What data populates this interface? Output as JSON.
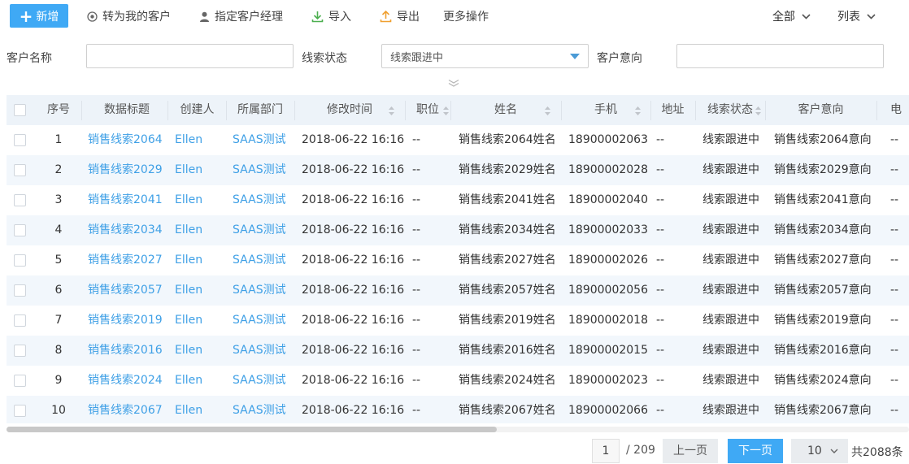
{
  "toolbar": {
    "add_label": "新增",
    "convert_label": "转为我的客户",
    "assign_label": "指定客户经理",
    "import_label": "导入",
    "export_label": "导出",
    "more_label": "更多操作",
    "scope_label": "全部",
    "view_label": "列表"
  },
  "filters": {
    "customer_name_label": "客户名称",
    "customer_name_value": "",
    "status_label": "线索状态",
    "status_value": "线索跟进中",
    "intent_label": "客户意向",
    "intent_value": ""
  },
  "table": {
    "columns": [
      "序号",
      "数据标题",
      "创建人",
      "所属部门",
      "修改时间",
      "职位",
      "姓名",
      "手机",
      "地址",
      "线索状态",
      "客户意向",
      "电"
    ],
    "rows": [
      {
        "no": "1",
        "title": "销售线索2064",
        "creator": "Ellen",
        "dept": "SAAS测试",
        "time": "2018-06-22 16:16",
        "position": "--",
        "name": "销售线索2064姓名",
        "phone": "18900002063",
        "address": "--",
        "status": "线索跟进中",
        "intent": "销售线索2064意向",
        "tel": "--"
      },
      {
        "no": "2",
        "title": "销售线索2029",
        "creator": "Ellen",
        "dept": "SAAS测试",
        "time": "2018-06-22 16:16",
        "position": "--",
        "name": "销售线索2029姓名",
        "phone": "18900002028",
        "address": "--",
        "status": "线索跟进中",
        "intent": "销售线索2029意向",
        "tel": "--"
      },
      {
        "no": "3",
        "title": "销售线索2041",
        "creator": "Ellen",
        "dept": "SAAS测试",
        "time": "2018-06-22 16:16",
        "position": "--",
        "name": "销售线索2041姓名",
        "phone": "18900002040",
        "address": "--",
        "status": "线索跟进中",
        "intent": "销售线索2041意向",
        "tel": "--"
      },
      {
        "no": "4",
        "title": "销售线索2034",
        "creator": "Ellen",
        "dept": "SAAS测试",
        "time": "2018-06-22 16:16",
        "position": "--",
        "name": "销售线索2034姓名",
        "phone": "18900002033",
        "address": "--",
        "status": "线索跟进中",
        "intent": "销售线索2034意向",
        "tel": "--"
      },
      {
        "no": "5",
        "title": "销售线索2027",
        "creator": "Ellen",
        "dept": "SAAS测试",
        "time": "2018-06-22 16:16",
        "position": "--",
        "name": "销售线索2027姓名",
        "phone": "18900002026",
        "address": "--",
        "status": "线索跟进中",
        "intent": "销售线索2027意向",
        "tel": "--"
      },
      {
        "no": "6",
        "title": "销售线索2057",
        "creator": "Ellen",
        "dept": "SAAS测试",
        "time": "2018-06-22 16:16",
        "position": "--",
        "name": "销售线索2057姓名",
        "phone": "18900002056",
        "address": "--",
        "status": "线索跟进中",
        "intent": "销售线索2057意向",
        "tel": "--"
      },
      {
        "no": "7",
        "title": "销售线索2019",
        "creator": "Ellen",
        "dept": "SAAS测试",
        "time": "2018-06-22 16:16",
        "position": "--",
        "name": "销售线索2019姓名",
        "phone": "18900002018",
        "address": "--",
        "status": "线索跟进中",
        "intent": "销售线索2019意向",
        "tel": "--"
      },
      {
        "no": "8",
        "title": "销售线索2016",
        "creator": "Ellen",
        "dept": "SAAS测试",
        "time": "2018-06-22 16:16",
        "position": "--",
        "name": "销售线索2016姓名",
        "phone": "18900002015",
        "address": "--",
        "status": "线索跟进中",
        "intent": "销售线索2016意向",
        "tel": "--"
      },
      {
        "no": "9",
        "title": "销售线索2024",
        "creator": "Ellen",
        "dept": "SAAS测试",
        "time": "2018-06-22 16:16",
        "position": "--",
        "name": "销售线索2024姓名",
        "phone": "18900002023",
        "address": "--",
        "status": "线索跟进中",
        "intent": "销售线索2024意向",
        "tel": "--"
      },
      {
        "no": "10",
        "title": "销售线索2067",
        "creator": "Ellen",
        "dept": "SAAS测试",
        "time": "2018-06-22 16:16",
        "position": "--",
        "name": "销售线索2067姓名",
        "phone": "18900002066",
        "address": "--",
        "status": "线索跟进中",
        "intent": "销售线索2067意向",
        "tel": "--"
      }
    ]
  },
  "pagination": {
    "current_page": "1",
    "total_pages": "/ 209",
    "prev_label": "上一页",
    "next_label": "下一页",
    "page_size": "10",
    "total_count": "共2088条"
  },
  "colors": {
    "accent": "#3fa9f5",
    "link": "#3fa0e6",
    "header_bg": "#edf3f9",
    "stripe_bg": "#f2f7fc"
  }
}
